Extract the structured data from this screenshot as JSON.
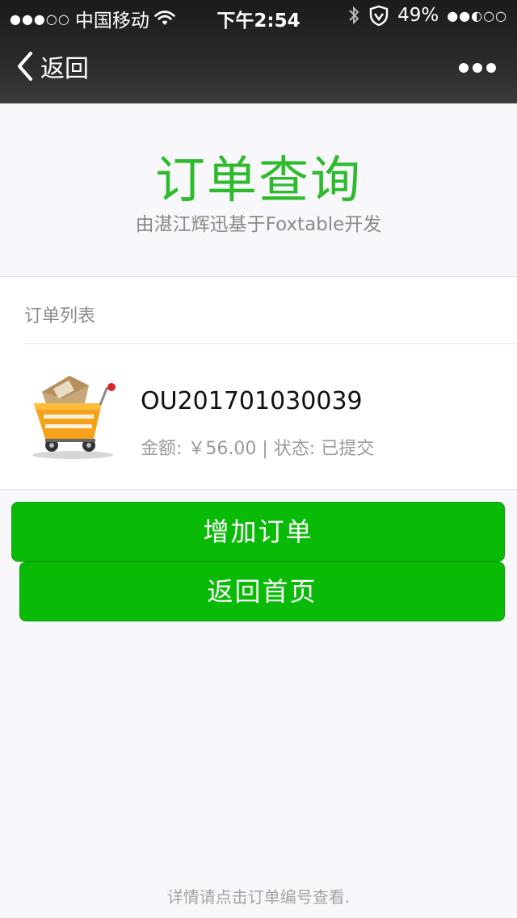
{
  "status_bar": {
    "signal": "●●●○○",
    "carrier": "中国移动",
    "time": "下午2:54",
    "battery_percent": "49%",
    "battery_dots": "●●◐○○"
  },
  "nav": {
    "back_label": "返回"
  },
  "header": {
    "title": "订单查询",
    "subtitle": "由湛江辉迅基于Foxtable开发"
  },
  "order_list": {
    "header": "订单列表",
    "items": [
      {
        "order_no": "OU201701030039",
        "meta": "金额: ￥56.00 | 状态: 已提交",
        "icon": "shopping-cart-icon"
      }
    ]
  },
  "buttons": {
    "add_order": "增加订单",
    "back_home": "返回首页"
  },
  "footer": {
    "note": "详情请点击订单编号查看."
  },
  "colors": {
    "accent_green": "#2dbb2d",
    "button_green": "#09bb07",
    "topbar": "#1b1b1d"
  }
}
